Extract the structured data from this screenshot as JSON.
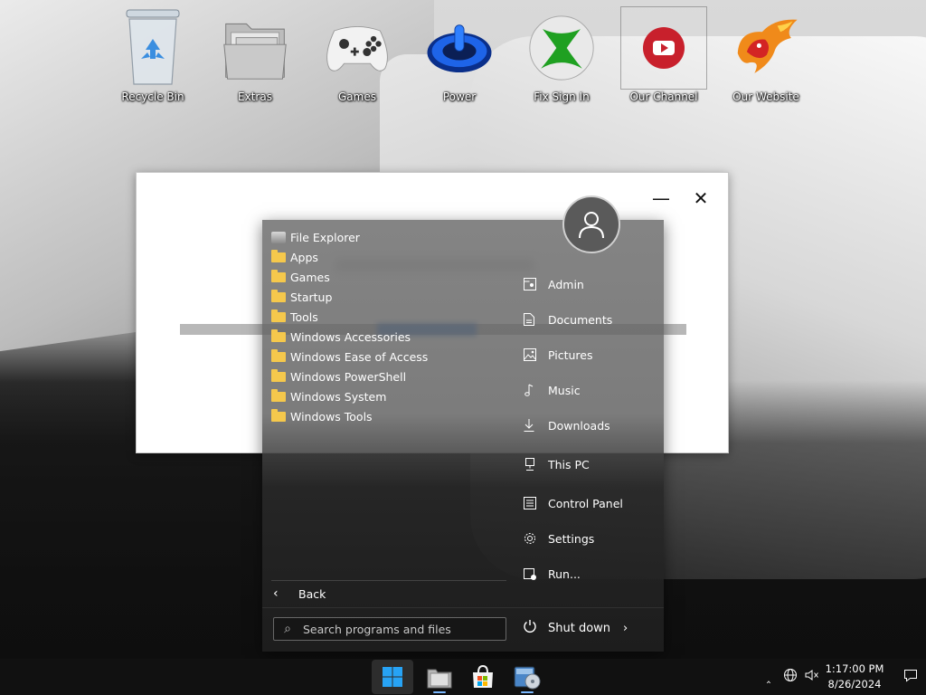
{
  "desktop_icons": [
    {
      "label": "Recycle Bin",
      "icon": "recycle-bin-icon"
    },
    {
      "label": "Extras",
      "icon": "folder-icon"
    },
    {
      "label": "Games",
      "icon": "gamepad-icon"
    },
    {
      "label": "Power",
      "icon": "power-icon"
    },
    {
      "label": "Fix Sign In",
      "icon": "xbox-icon"
    },
    {
      "label": "Our Channel",
      "icon": "youtube-icon"
    },
    {
      "label": "Our Website",
      "icon": "phoenix-icon"
    }
  ],
  "start_menu": {
    "left_items": [
      {
        "label": "File Explorer",
        "icon": "file-explorer-icon"
      },
      {
        "label": "Apps",
        "icon": "folder-icon"
      },
      {
        "label": "Games",
        "icon": "folder-icon"
      },
      {
        "label": "Startup",
        "icon": "folder-icon"
      },
      {
        "label": "Tools",
        "icon": "folder-icon"
      },
      {
        "label": "Windows Accessories",
        "icon": "folder-icon"
      },
      {
        "label": "Windows Ease of Access",
        "icon": "folder-icon"
      },
      {
        "label": "Windows PowerShell",
        "icon": "folder-icon"
      },
      {
        "label": "Windows System",
        "icon": "folder-icon"
      },
      {
        "label": "Windows Tools",
        "icon": "folder-icon"
      }
    ],
    "back_label": "Back",
    "search_placeholder": "Search programs and files",
    "right_items": [
      {
        "label": "Admin",
        "icon": "user-folder-icon"
      },
      {
        "label": "Documents",
        "icon": "document-icon"
      },
      {
        "label": "Pictures",
        "icon": "picture-icon"
      },
      {
        "label": "Music",
        "icon": "music-note-icon"
      },
      {
        "label": "Downloads",
        "icon": "download-icon"
      },
      {
        "label": "This PC",
        "icon": "computer-icon"
      },
      {
        "label": "Control Panel",
        "icon": "control-panel-icon"
      },
      {
        "label": "Settings",
        "icon": "gear-icon"
      },
      {
        "label": "Run...",
        "icon": "run-icon"
      }
    ],
    "shutdown_label": "Shut down"
  },
  "window_controls": {
    "minimize": "—",
    "close": "✕"
  },
  "taskbar": {
    "apps": [
      "start-button",
      "file-explorer",
      "microsoft-store",
      "media-app"
    ],
    "time": "1:17:00 PM",
    "date": "8/26/2024"
  },
  "colors": {
    "accent": "#2a74d6",
    "folder": "#f5c84c",
    "taskbar": "#121212"
  }
}
